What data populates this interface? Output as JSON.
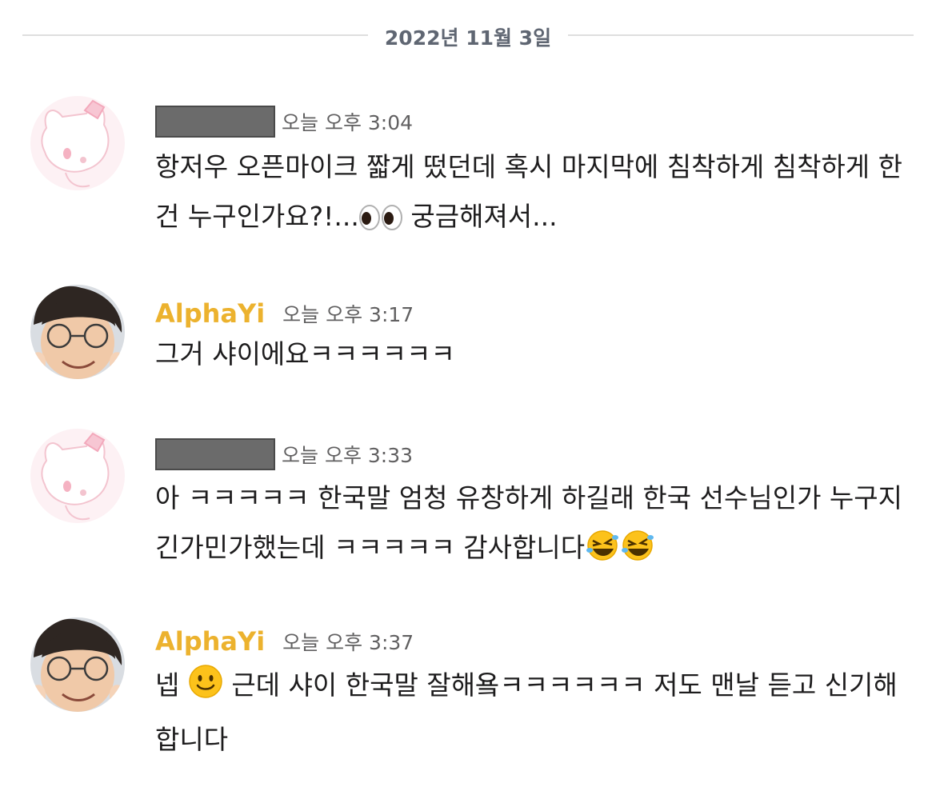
{
  "date_divider": "2022년 11월 3일",
  "messages": [
    {
      "author": "",
      "author_redacted": true,
      "avatar": "hello-kitty-avatar",
      "time": "오늘 오후 3:04",
      "text_before": "항저우 오픈마이크 짧게 떴던데 혹시 마지막에 침착하게 침착하게 한건 누구인가요?!...",
      "emoji": "eyes-emoji",
      "text_after": " 궁금해져서..."
    },
    {
      "author": "AlphaYi",
      "avatar": "alphayi-avatar",
      "time": "오늘 오후 3:17",
      "text": "그거 샤이에요ㅋㅋㅋㅋㅋㅋ"
    },
    {
      "author": "",
      "author_redacted": true,
      "avatar": "hello-kitty-avatar",
      "time": "오늘 오후 3:33",
      "text": "아 ㅋㅋㅋㅋㅋ 한국말 엄청 유창하게 하길래 한국 선수님인가 누구지 긴가민가했는데 ㅋㅋㅋㅋㅋ 감사합니다",
      "emojis": [
        "rolling-on-floor-laughing-emoji",
        "rolling-on-floor-laughing-emoji"
      ]
    },
    {
      "author": "AlphaYi",
      "avatar": "alphayi-avatar",
      "time": "오늘 오후 3:37",
      "text_before": "넵 ",
      "emoji": "slightly-smiling-face-emoji",
      "text_after": " 근데 샤이 한국말 잘해욬ㅋㅋㅋㅋㅋㅋ 저도 맨날 듣고 신기해합니다"
    }
  ],
  "colors": {
    "username": "#ecb22e",
    "timestamp": "#616061",
    "divider_text": "#5f6672",
    "divider_line": "#dedede"
  }
}
